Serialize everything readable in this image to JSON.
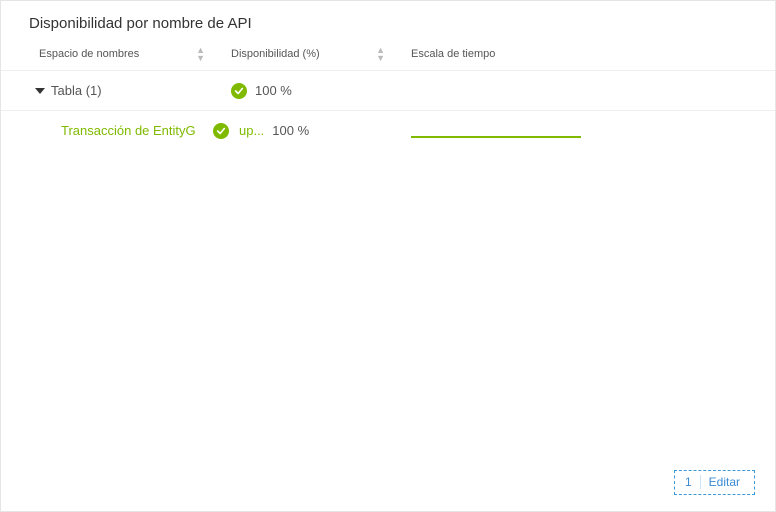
{
  "title": "Disponibilidad por nombre de API",
  "columns": {
    "namespace": "Espacio de nombres",
    "availability": "Disponibilidad (%)",
    "timescale": "Escala de tiempo"
  },
  "group": {
    "label": "Tabla (1)",
    "availability": "100 %"
  },
  "item": {
    "label_prefix": "Transacción de EntityG",
    "label_suffix": "up...",
    "availability": "100 %"
  },
  "edit": {
    "count": "1",
    "label": "Editar"
  },
  "colors": {
    "accent_green": "#7fba00",
    "link_blue": "#3b8bd4"
  }
}
